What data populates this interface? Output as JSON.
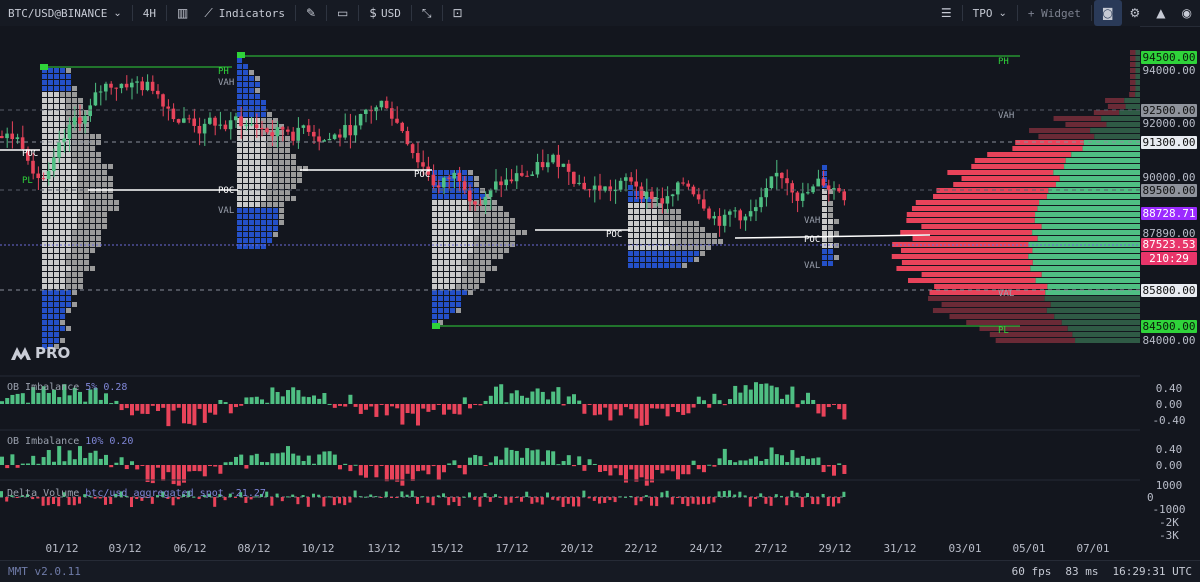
{
  "toolbar": {
    "symbol": "BTC/USD@BINANCE",
    "interval": "4H",
    "indicators_label": "Indicators",
    "currency": "USD",
    "layout_mode": "TPO",
    "widget_label": "+ Widget"
  },
  "logo": {
    "text": "PRO"
  },
  "price_axis": {
    "ticks": [
      "94000.00",
      "92000.00",
      "90000.00",
      "87890.00",
      "84000.00"
    ],
    "highlighted": [
      {
        "text": "94500.00",
        "color": "#2fd33a",
        "fg": "#0b1a0b"
      },
      {
        "text": "92500.00",
        "color": "#8f939c",
        "fg": "#111"
      },
      {
        "text": "91300.00",
        "color": "#e9ecf2",
        "fg": "#111"
      },
      {
        "text": "89500.00",
        "color": "#8f939c",
        "fg": "#111"
      },
      {
        "text": "88728.71",
        "color": "#9b2bff",
        "fg": "#ffffff"
      },
      {
        "text": "87523.53",
        "color": "#e8356a",
        "fg": "#ffffff"
      },
      {
        "text": "210:29",
        "color": "#e8356a",
        "fg": "#ffffff"
      },
      {
        "text": "85800.00",
        "color": "#e9ecf2",
        "fg": "#111"
      },
      {
        "text": "84500.00",
        "color": "#2fd33a",
        "fg": "#0b1a0b"
      }
    ]
  },
  "tpo_labels": {
    "ph": "PH",
    "pl": "PL",
    "vah": "VAH",
    "val": "VAL",
    "poc": "POC"
  },
  "indicators": {
    "ob1": {
      "name": "OB Imbalance",
      "params": "5% 0.28",
      "ticks": [
        "0.40",
        "0.00",
        "-0.40"
      ]
    },
    "ob2": {
      "name": "OB Imbalance",
      "params": "10% 0.20",
      "ticks": [
        "0.40",
        "0.00"
      ]
    },
    "delta": {
      "name": "Delta Volume",
      "params": "btc/usd aggregated spot  -21.27",
      "ticks": [
        "1000",
        "0",
        "-1000",
        "-2K",
        "-3K"
      ]
    }
  },
  "dates": [
    "01/12",
    "03/12",
    "06/12",
    "08/12",
    "10/12",
    "13/12",
    "15/12",
    "17/12",
    "20/12",
    "22/12",
    "24/12",
    "27/12",
    "29/12",
    "31/12",
    "03/01",
    "05/01",
    "07/01"
  ],
  "footer": {
    "version": "MMT v2.0.11",
    "fps": "60 fps",
    "latency": "83 ms",
    "time": "16:29:31 UTC"
  },
  "colors": {
    "up": "#4fbf83",
    "down": "#e8435a",
    "tpo_blue": "#2450c8",
    "tpo_gray": "#bfbfbf",
    "level_green": "#2fd33a"
  }
}
